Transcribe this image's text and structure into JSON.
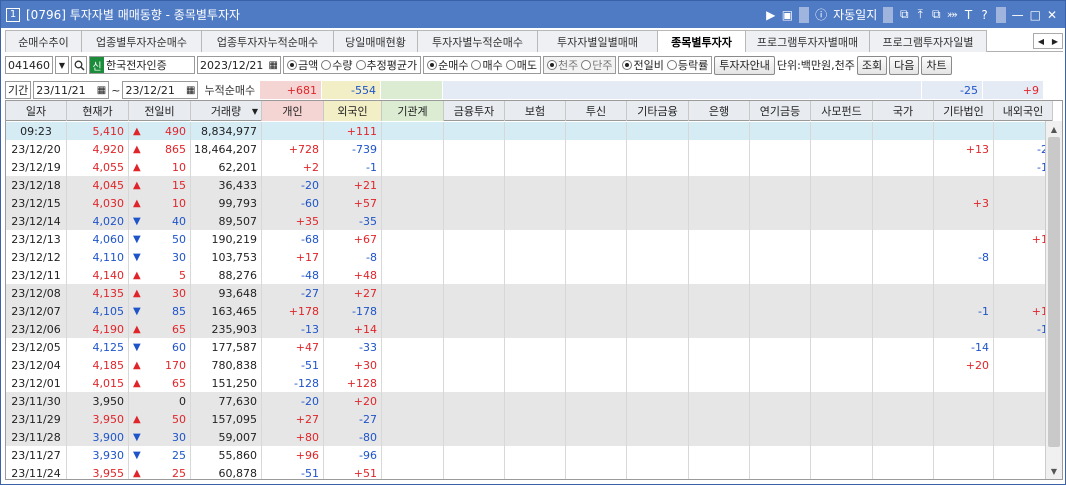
{
  "window": {
    "number": "1",
    "title": "[0796] 투자자별 매매동향 - 종목별투자자",
    "actions": {
      "play": "▶",
      "box": "▣",
      "info": "ⓘ",
      "auto_journal": "자동일지",
      "icons": [
        "⧉",
        "⤒",
        "⧉",
        "⤗",
        "T",
        "?"
      ],
      "minimize": "—",
      "maximize": "□",
      "close": "✕"
    }
  },
  "tabs": [
    "순매수추이",
    "업종별투자자순매수",
    "업종투자자누적순매수",
    "당일매매현황",
    "투자자별누적순매수",
    "투자자별일별매매",
    "종목별투자자",
    "프로그램투자자별매매",
    "프로그램투자자일별"
  ],
  "active_tab": 6,
  "controls": {
    "code": "041460",
    "badge": "신",
    "name": "한국전자인증",
    "date": "2023/12/21",
    "r1": [
      "금액",
      "수량",
      "추정평균가"
    ],
    "r1_on": 0,
    "r2": [
      "순매수",
      "매수",
      "매도"
    ],
    "r2_on": 0,
    "r3": [
      "천주",
      "단주"
    ],
    "r3_on": 0,
    "r4": [
      "전일비",
      "등락률"
    ],
    "r4_on": 0,
    "guide_button": "투자자안내",
    "unit": "단위:백만원,천주",
    "query_button": "조회",
    "next_button": "다음",
    "chart_button": "차트"
  },
  "period": {
    "label": "기간",
    "from": "23/11/21",
    "tilde": "~",
    "to": "23/12/21",
    "cum_label": "누적순매수"
  },
  "summary": {
    "individual": "+681",
    "foreign": "-554",
    "etc_corp": "-25",
    "domestic_foreign": "+9"
  },
  "columns": [
    "일자",
    "현재가",
    "전일비",
    "거래량",
    "개인",
    "외국인",
    "기관계",
    "금융투자",
    "보험",
    "투신",
    "기타금융",
    "은행",
    "연기금등",
    "사모펀드",
    "국가",
    "기타법인",
    "내외국인"
  ],
  "colors": {
    "red": "#e0252a",
    "blue": "#1e54c9",
    "band_gray": "#e6e6e6",
    "highlight": "#d6ecf5",
    "ind_header": "#f5d5d3",
    "for_header": "#f2efc6",
    "inst_header": "#dcecd2"
  },
  "rows": [
    {
      "date": "09:23",
      "price": "5,410",
      "dir": "up",
      "chg": "490",
      "vol": "8,834,977",
      "ind": "",
      "for": "+111",
      "etc": "",
      "dom": ""
    },
    {
      "date": "23/12/20",
      "price": "4,920",
      "dir": "up",
      "chg": "865",
      "vol": "18,464,207",
      "ind": "+728",
      "for": "-739",
      "etc": "+13",
      "dom": "-2"
    },
    {
      "date": "23/12/19",
      "price": "4,055",
      "dir": "up",
      "chg": "10",
      "vol": "62,201",
      "ind": "+2",
      "for": "-1",
      "etc": "",
      "dom": "-1"
    },
    {
      "date": "23/12/18",
      "price": "4,045",
      "dir": "up",
      "chg": "15",
      "vol": "36,433",
      "ind": "-20",
      "for": "+21",
      "etc": "",
      "dom": ""
    },
    {
      "date": "23/12/15",
      "price": "4,030",
      "dir": "up",
      "chg": "10",
      "vol": "99,793",
      "ind": "-60",
      "for": "+57",
      "etc": "+3",
      "dom": ""
    },
    {
      "date": "23/12/14",
      "price": "4,020",
      "dir": "down",
      "chg": "40",
      "vol": "89,507",
      "ind": "+35",
      "for": "-35",
      "etc": "",
      "dom": ""
    },
    {
      "date": "23/12/13",
      "price": "4,060",
      "dir": "down",
      "chg": "50",
      "vol": "190,219",
      "ind": "-68",
      "for": "+67",
      "etc": "",
      "dom": "+1"
    },
    {
      "date": "23/12/12",
      "price": "4,110",
      "dir": "down",
      "chg": "30",
      "vol": "103,753",
      "ind": "+17",
      "for": "-8",
      "etc": "-8",
      "dom": ""
    },
    {
      "date": "23/12/11",
      "price": "4,140",
      "dir": "up",
      "chg": "5",
      "vol": "88,276",
      "ind": "-48",
      "for": "+48",
      "etc": "",
      "dom": ""
    },
    {
      "date": "23/12/08",
      "price": "4,135",
      "dir": "up",
      "chg": "30",
      "vol": "93,648",
      "ind": "-27",
      "for": "+27",
      "etc": "",
      "dom": ""
    },
    {
      "date": "23/12/07",
      "price": "4,105",
      "dir": "down",
      "chg": "85",
      "vol": "163,465",
      "ind": "+178",
      "for": "-178",
      "etc": "-1",
      "dom": "+1"
    },
    {
      "date": "23/12/06",
      "price": "4,190",
      "dir": "up",
      "chg": "65",
      "vol": "235,903",
      "ind": "-13",
      "for": "+14",
      "etc": "",
      "dom": "-1"
    },
    {
      "date": "23/12/05",
      "price": "4,125",
      "dir": "down",
      "chg": "60",
      "vol": "177,587",
      "ind": "+47",
      "for": "-33",
      "etc": "-14",
      "dom": ""
    },
    {
      "date": "23/12/04",
      "price": "4,185",
      "dir": "up",
      "chg": "170",
      "vol": "780,838",
      "ind": "-51",
      "for": "+30",
      "etc": "+20",
      "dom": ""
    },
    {
      "date": "23/12/01",
      "price": "4,015",
      "dir": "up",
      "chg": "65",
      "vol": "151,250",
      "ind": "-128",
      "for": "+128",
      "etc": "",
      "dom": ""
    },
    {
      "date": "23/11/30",
      "price": "3,950",
      "dir": "flat",
      "chg": "0",
      "vol": "77,630",
      "ind": "-20",
      "for": "+20",
      "etc": "",
      "dom": ""
    },
    {
      "date": "23/11/29",
      "price": "3,950",
      "dir": "up",
      "chg": "50",
      "vol": "157,095",
      "ind": "+27",
      "for": "-27",
      "etc": "",
      "dom": ""
    },
    {
      "date": "23/11/28",
      "price": "3,900",
      "dir": "down",
      "chg": "30",
      "vol": "59,007",
      "ind": "+80",
      "for": "-80",
      "etc": "",
      "dom": ""
    },
    {
      "date": "23/11/27",
      "price": "3,930",
      "dir": "down",
      "chg": "25",
      "vol": "55,860",
      "ind": "+96",
      "for": "-96",
      "etc": "",
      "dom": ""
    },
    {
      "date": "23/11/24",
      "price": "3,955",
      "dir": "up",
      "chg": "25",
      "vol": "60,878",
      "ind": "-51",
      "for": "+51",
      "etc": "",
      "dom": ""
    }
  ]
}
